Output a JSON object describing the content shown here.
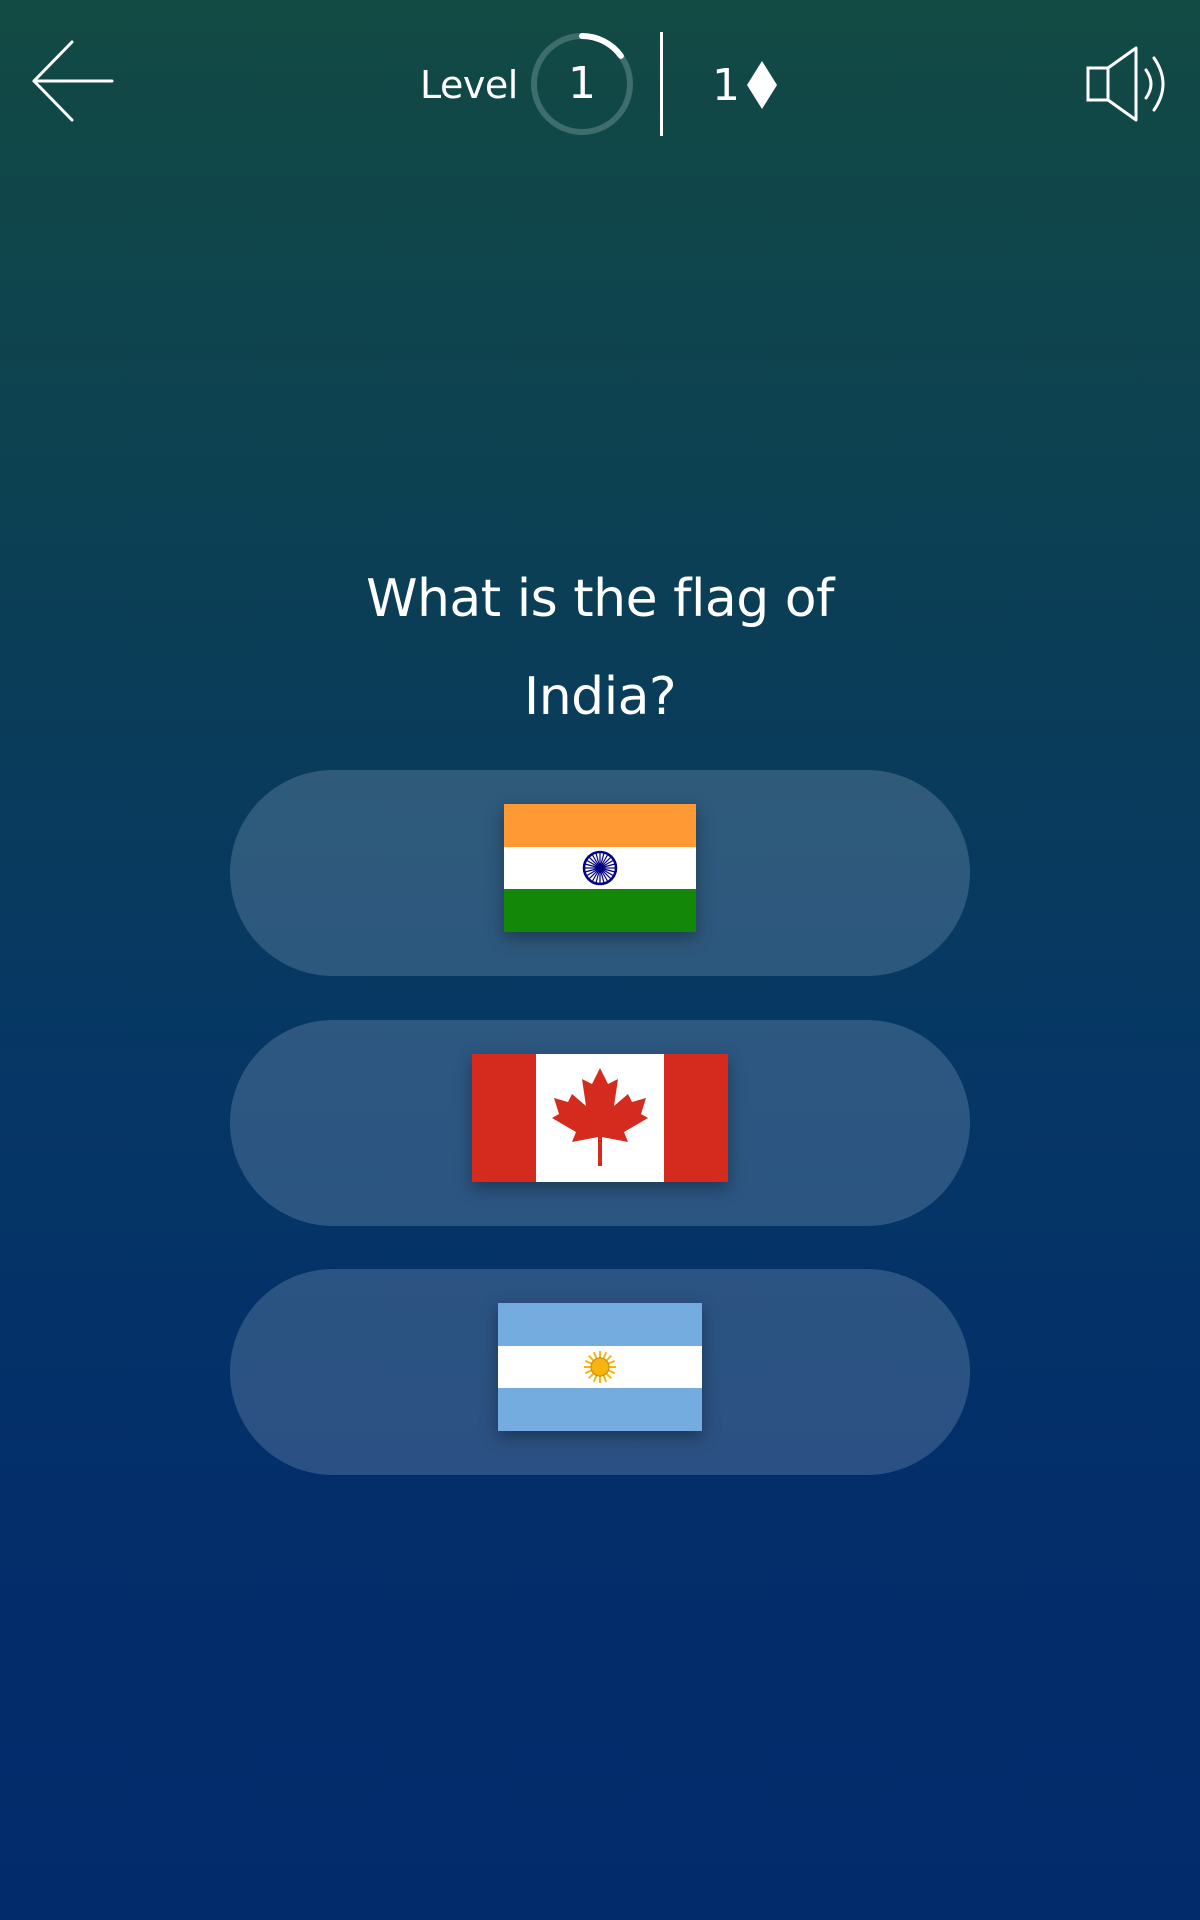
{
  "header": {
    "level_label": "Level",
    "level_number": "1",
    "level_progress": 0.15,
    "gem_count": "1",
    "gem_icon": "diamond-icon",
    "back_icon": "arrow-left-icon",
    "sound_icon": "speaker-icon"
  },
  "question": {
    "line1": "What is the flag of",
    "line2": "India?"
  },
  "answers": [
    {
      "flag": "India"
    },
    {
      "flag": "Canada"
    },
    {
      "flag": "Argentina"
    }
  ],
  "colors": {
    "bg_top": "#124a44",
    "bg_bottom": "#022b6b",
    "answer_bg": "#4c6b8c",
    "india_saffron": "#ff9933",
    "india_green": "#138808",
    "india_chakra": "#000080",
    "canada_red": "#d52b1e",
    "argentina_blue": "#74acdf",
    "argentina_sun": "#f6b40e"
  }
}
